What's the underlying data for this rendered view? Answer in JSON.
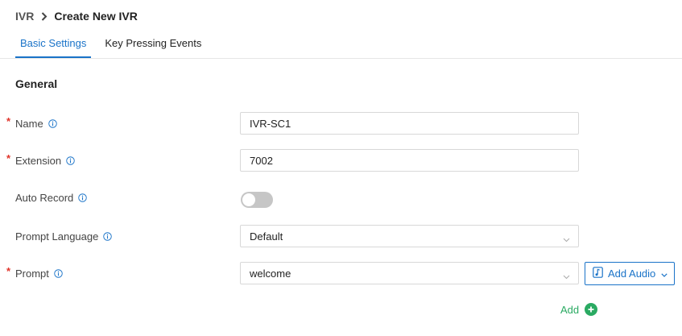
{
  "breadcrumb": {
    "parent": "IVR",
    "current": "Create New IVR"
  },
  "tabs": [
    {
      "label": "Basic Settings",
      "active": true
    },
    {
      "label": "Key Pressing Events",
      "active": false
    }
  ],
  "section": {
    "title": "General"
  },
  "form": {
    "name": {
      "label": "Name",
      "required": true,
      "value": "IVR-SC1"
    },
    "extension": {
      "label": "Extension",
      "required": true,
      "value": "7002"
    },
    "auto_record": {
      "label": "Auto Record",
      "required": false,
      "enabled": false
    },
    "prompt_language": {
      "label": "Prompt Language",
      "required": false,
      "selected": "Default"
    },
    "prompt": {
      "label": "Prompt",
      "required": true,
      "selected": "welcome"
    }
  },
  "add_audio_label": "Add Audio",
  "add_label": "Add",
  "required_marker": "*",
  "colors": {
    "accent": "#1a73c8",
    "required": "#e0342a",
    "add": "#2aaa62",
    "toggle_off": "#c6c6c6"
  }
}
